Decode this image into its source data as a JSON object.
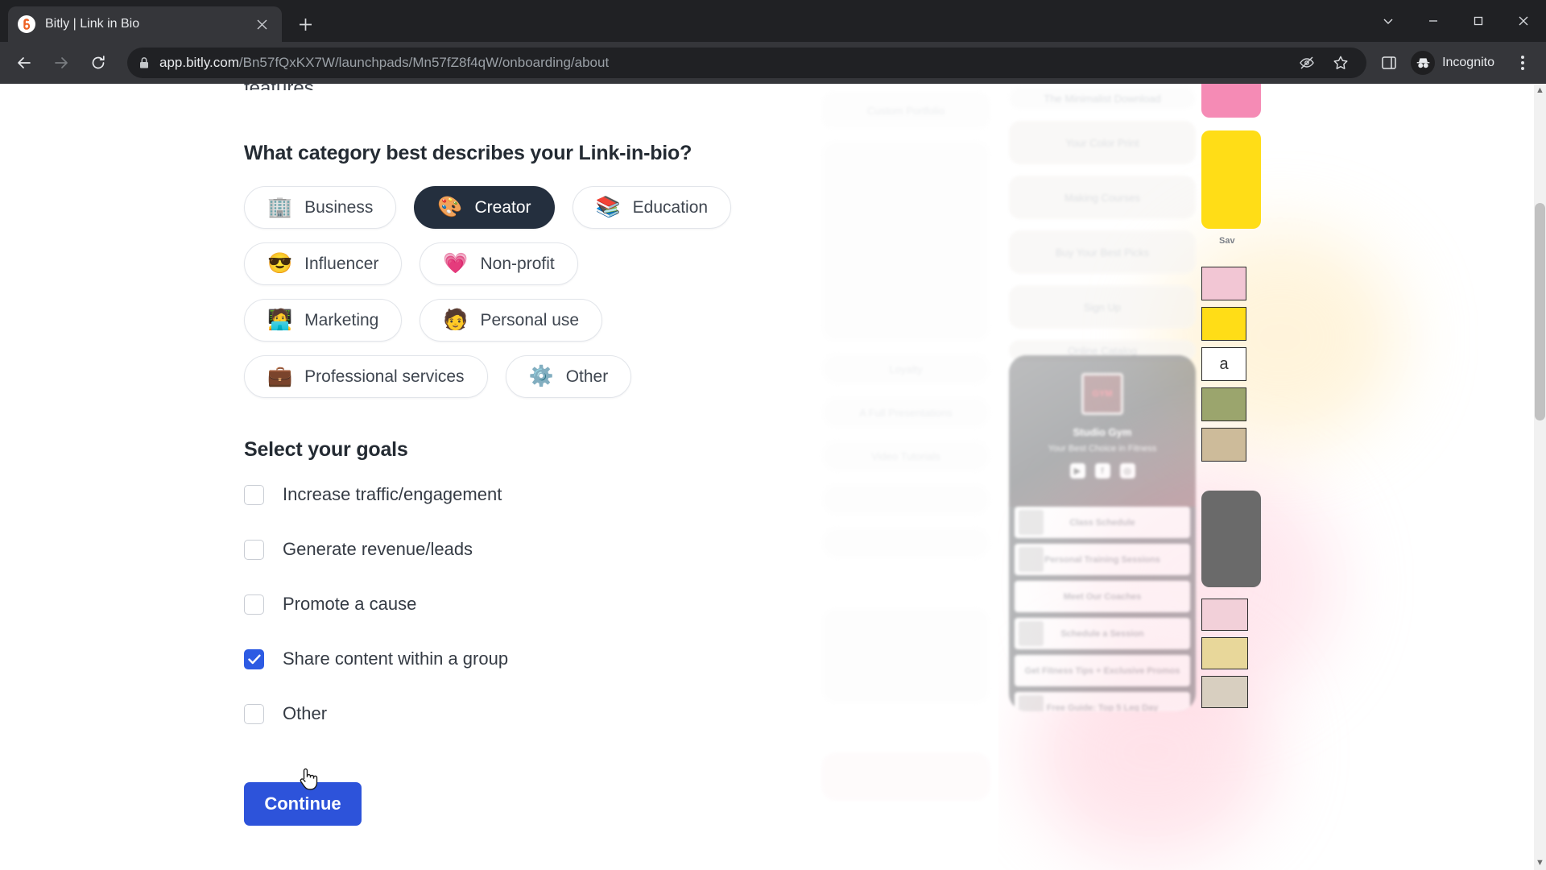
{
  "browser": {
    "tab": {
      "title": "Bitly | Link in Bio",
      "favicon_icon": "bitly-logo-icon",
      "close_icon": "close-icon"
    },
    "new_tab_icon": "plus-icon",
    "window_controls": {
      "minimize_all_icon": "chevron-down-icon",
      "minimize_icon": "minimize-icon",
      "maximize_icon": "maximize-icon",
      "close_icon": "window-close-icon"
    },
    "nav": {
      "back_icon": "back-arrow-icon",
      "forward_icon": "forward-arrow-icon",
      "reload_icon": "reload-icon"
    },
    "omnibox": {
      "lock_icon": "lock-icon",
      "url_host": "app.bitly.com",
      "url_path": "/Bn57fQxKX7W/launchpads/Mn57fZ8f4qW/onboarding/about",
      "third_party_cookie_icon": "eye-slash-icon",
      "bookmark_icon": "star-icon",
      "side_panel_icon": "side-panel-icon"
    },
    "profile": {
      "avatar_icon": "incognito-icon",
      "label": "Incognito"
    },
    "menu_icon": "three-dots-menu-icon"
  },
  "page": {
    "cut_off_text": "features.",
    "category_question": "What category best describes your Link-in-bio?",
    "categories": [
      {
        "label": "Business",
        "emoji": "🏢",
        "icon_name": "office-building-emoji",
        "selected": false
      },
      {
        "label": "Creator",
        "emoji": "🎨",
        "icon_name": "artist-palette-emoji",
        "selected": true
      },
      {
        "label": "Education",
        "emoji": "📚",
        "icon_name": "books-emoji",
        "selected": false
      },
      {
        "label": "Influencer",
        "emoji": "😎",
        "icon_name": "sunglasses-face-emoji",
        "selected": false
      },
      {
        "label": "Non-profit",
        "emoji": "💗",
        "icon_name": "growing-heart-emoji",
        "selected": false
      },
      {
        "label": "Marketing",
        "emoji": "🧑‍💻",
        "icon_name": "technologist-emoji",
        "selected": false
      },
      {
        "label": "Personal use",
        "emoji": "🧑",
        "icon_name": "person-emoji",
        "selected": false
      },
      {
        "label": "Professional services",
        "emoji": "💼",
        "icon_name": "briefcase-emoji",
        "selected": false
      },
      {
        "label": "Other",
        "emoji": "⚙️",
        "icon_name": "gear-emoji",
        "selected": false
      }
    ],
    "goals_title": "Select your goals",
    "goals": [
      {
        "label": "Increase traffic/engagement",
        "checked": false
      },
      {
        "label": "Generate revenue/leads",
        "checked": false
      },
      {
        "label": "Promote a cause",
        "checked": false
      },
      {
        "label": "Share content within a group",
        "checked": true
      },
      {
        "label": "Other",
        "checked": false
      }
    ],
    "continue_label": "Continue",
    "accent_color": "#2d53da",
    "checkbox_checked_color": "#2d5be3",
    "selected_chip_color": "#242f3e"
  },
  "preview": {
    "profile_name": "Studio Gym",
    "tagline": "Your Best Choice in Fitness",
    "social_icons": [
      "youtube-icon",
      "facebook-icon",
      "instagram-icon"
    ],
    "links": [
      "Class Schedule",
      "Personal Training Sessions",
      "Meet Our Coaches",
      "Schedule a Session",
      "Get Fitness Tips + Exclusive Promos",
      "Free Guide: Top 5 Leg Day"
    ],
    "background_cards": [
      "The Minimalist Download",
      "Your Color Print",
      "Making Courses",
      "Buy Your Best Picks",
      "Sign Up",
      "Online Catalog",
      "Custom Portfolio",
      "Loyalty",
      "A Full Presentations",
      "Video Tutorials"
    ],
    "thumb_label": "Sav"
  },
  "scrollbar": {
    "up_arrow_icon": "scroll-up-arrow-icon",
    "down_arrow_icon": "scroll-down-arrow-icon"
  }
}
